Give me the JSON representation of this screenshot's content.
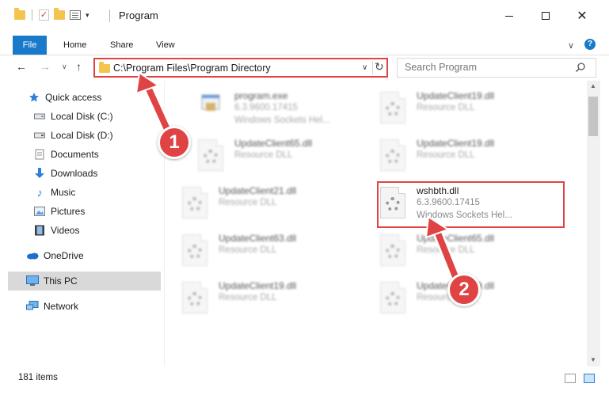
{
  "window": {
    "title": "Program",
    "controls": {
      "minimize": "",
      "maximize": "",
      "close": "✕"
    }
  },
  "ribbon": {
    "tabs": [
      "File",
      "Home",
      "Share",
      "View"
    ],
    "chevron": "∨",
    "help": "?"
  },
  "address_bar": {
    "path": "C:\\Program Files\\Program Directory",
    "dropdown": "∨",
    "refresh": "↻"
  },
  "search": {
    "placeholder": "Search Program"
  },
  "nav": {
    "back": "←",
    "forward": "→",
    "recent": "∨",
    "up": "↑"
  },
  "sidebar": {
    "items": [
      {
        "label": "Quick access",
        "icon": "star-icon",
        "pinned": false
      },
      {
        "label": "Local Disk (C:)",
        "icon": "drive-icon",
        "pinned": true
      },
      {
        "label": "Local Disk (D:)",
        "icon": "drive-icon",
        "pinned": true
      },
      {
        "label": "Documents",
        "icon": "documents-icon",
        "pinned": true
      },
      {
        "label": "Downloads",
        "icon": "download-icon",
        "pinned": true
      },
      {
        "label": "Music",
        "icon": "music-icon",
        "pinned": true
      },
      {
        "label": "Pictures",
        "icon": "pictures-icon",
        "pinned": true
      },
      {
        "label": "Videos",
        "icon": "videos-icon",
        "pinned": true
      },
      {
        "label": "OneDrive",
        "icon": "onedrive-icon",
        "pinned": false
      },
      {
        "label": "This PC",
        "icon": "this-pc-icon",
        "pinned": false,
        "selected": true
      },
      {
        "label": "Network",
        "icon": "network-icon",
        "pinned": false
      }
    ],
    "pin_glyph": "📌"
  },
  "files": [
    {
      "name": "program.exe",
      "meta1": "6.3.9600.17415",
      "meta2": "Windows Sockets Hel...",
      "icon": "exe-icon",
      "blurred": true
    },
    {
      "name": "UpdateClient19.dll",
      "meta1": "Resource DLL",
      "meta2": "",
      "icon": "dll-icon",
      "blurred": true
    },
    {
      "name": "UpdateClient65.dll",
      "meta1": "Resource DLL",
      "meta2": "",
      "icon": "dll-icon",
      "blurred": true
    },
    {
      "name": "UpdateClient19.dll",
      "meta1": "Resource DLL",
      "meta2": "",
      "icon": "dll-icon",
      "blurred": true
    },
    {
      "name": "UpdateClient21.dll",
      "meta1": "Resource DLL",
      "meta2": "",
      "icon": "dll-icon",
      "blurred": true
    },
    {
      "name": "wshbth.dll",
      "meta1": "6.3.9600.17415",
      "meta2": "Windows Sockets Hel...",
      "icon": "dll-icon",
      "blurred": false,
      "highlighted": true
    },
    {
      "name": "UpdateClient63.dll",
      "meta1": "Resource DLL",
      "meta2": "",
      "icon": "dll-icon",
      "blurred": true
    },
    {
      "name": "UpdateClient65.dll",
      "meta1": "Resource DLL",
      "meta2": "",
      "icon": "dll-icon",
      "blurred": true
    },
    {
      "name": "UpdateClient19.dll",
      "meta1": "Resource DLL",
      "meta2": "",
      "icon": "dll-icon",
      "blurred": true
    },
    {
      "name": "UpdateClient19.dll",
      "meta1": "Resource DLL",
      "meta2": "",
      "icon": "dll-icon",
      "blurred": true
    }
  ],
  "status": {
    "item_count": "181 items"
  },
  "scrollbar": {
    "up": "▲",
    "down": "▼"
  },
  "annotations": {
    "badge_1": "1",
    "badge_2": "2",
    "color": "#e04343"
  },
  "colors": {
    "accent": "#1979ca",
    "highlight": "#e04343",
    "folder": "#f4c44e"
  }
}
